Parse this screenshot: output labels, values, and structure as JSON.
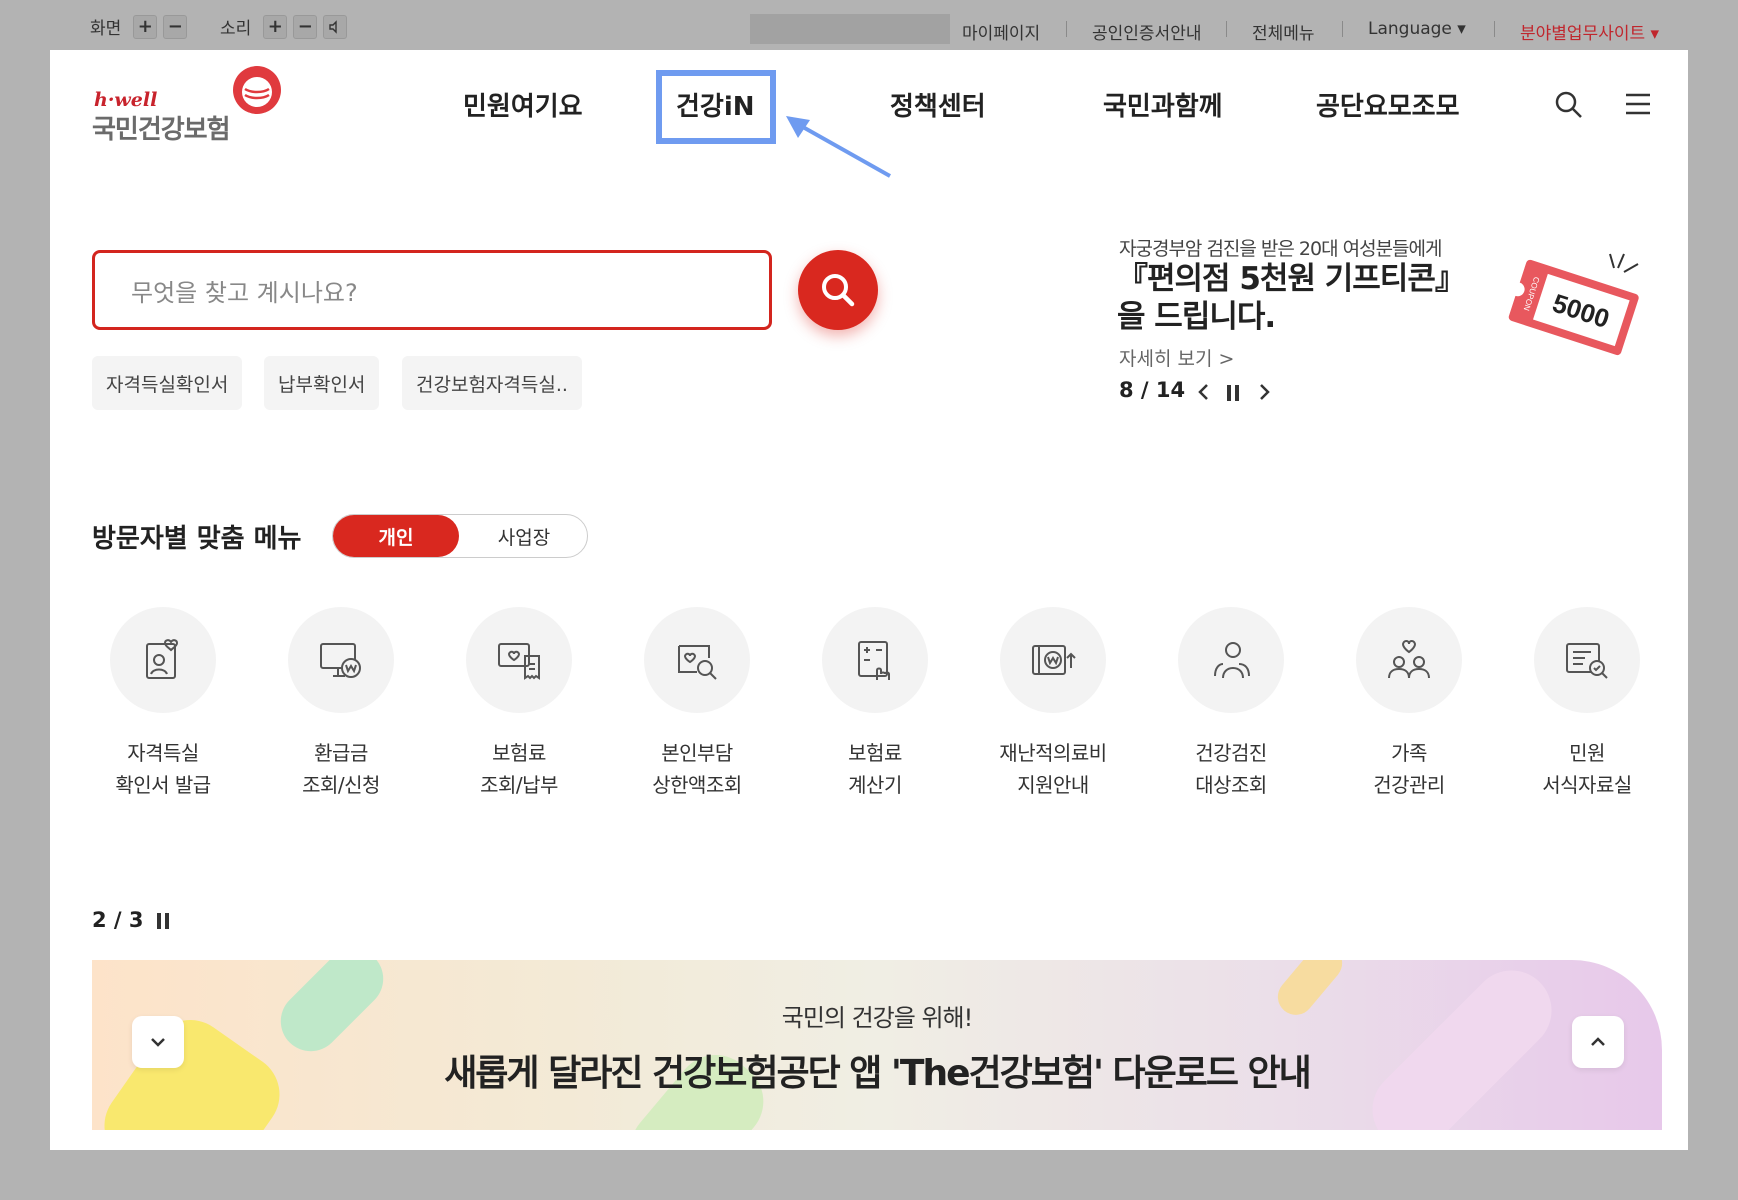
{
  "utility": {
    "screen_label": "화면",
    "sound_label": "소리",
    "plus": "+",
    "minus": "−",
    "links": [
      "마이페이지",
      "공인인증서안내",
      "전체메뉴",
      "Language ▾",
      "분야별업무사이트 ▾"
    ]
  },
  "logo": {
    "en": "h·well",
    "ko": "국민건강보험"
  },
  "nav": [
    "민원여기요",
    "건강iN",
    "정책센터",
    "국민과함께",
    "공단요모조모"
  ],
  "search": {
    "placeholder": "무엇을 찾고 계시나요?"
  },
  "chips": [
    "자격득실확인서",
    "납부확인서",
    "건강보험자격득실.."
  ],
  "promo": {
    "subtitle": "자궁경부암 검진을 받은 20대 여성분들에게",
    "title": "『편의점 5천원 기프티콘』을 드립니다.",
    "more": "자세히 보기 >",
    "counter": "8 / 14",
    "coupon_value": "5000",
    "coupon_label": "COUPON"
  },
  "visitor_menu": {
    "title": "방문자별 맞춤 메뉴",
    "tabs": [
      "개인",
      "사업장"
    ],
    "items": [
      {
        "label": "자격득실\n확인서 발급",
        "icon": "id-card-icon"
      },
      {
        "label": "환급금\n조회/신청",
        "icon": "monitor-won-icon"
      },
      {
        "label": "보험료\n조회/납부",
        "icon": "receipt-heart-icon"
      },
      {
        "label": "본인부담\n상한액조회",
        "icon": "heart-search-icon"
      },
      {
        "label": "보험료\n계산기",
        "icon": "calculator-icon"
      },
      {
        "label": "재난적의료비\n지원안내",
        "icon": "won-support-icon"
      },
      {
        "label": "건강검진\n대상조회",
        "icon": "person-search-icon"
      },
      {
        "label": "가족\n건강관리",
        "icon": "family-heart-icon"
      },
      {
        "label": "민원\n서식자료실",
        "icon": "document-search-icon"
      }
    ]
  },
  "bottom_banner": {
    "counter": "2 / 3",
    "line1": "국민의 건강을 위해!",
    "line2": "새롭게 달라진 건강보험공단 앱 'The건강보험' 다운로드 안내"
  },
  "colors": {
    "brand_red": "#d9281f",
    "highlight_blue": "#6f9bf0"
  }
}
